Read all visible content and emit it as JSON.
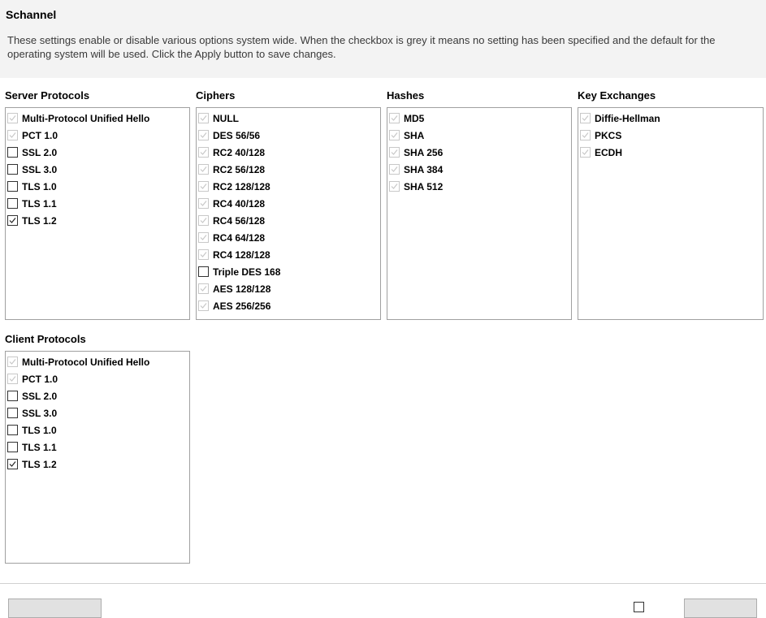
{
  "header": {
    "title": "Schannel",
    "description": "These settings enable or disable various options system wide. When the checkbox is grey it means no setting has been specified and the default for the operating system will be used. Click the Apply button to save changes."
  },
  "server_protocols": {
    "label": "Server Protocols",
    "items": [
      {
        "label": "Multi-Protocol Unified Hello",
        "state": "grey"
      },
      {
        "label": "PCT 1.0",
        "state": "grey"
      },
      {
        "label": "SSL 2.0",
        "state": "unchecked"
      },
      {
        "label": "SSL 3.0",
        "state": "unchecked"
      },
      {
        "label": "TLS 1.0",
        "state": "unchecked"
      },
      {
        "label": "TLS 1.1",
        "state": "unchecked"
      },
      {
        "label": "TLS 1.2",
        "state": "checked"
      }
    ]
  },
  "ciphers": {
    "label": "Ciphers",
    "items": [
      {
        "label": "NULL",
        "state": "grey"
      },
      {
        "label": "DES 56/56",
        "state": "grey"
      },
      {
        "label": "RC2 40/128",
        "state": "grey"
      },
      {
        "label": "RC2 56/128",
        "state": "grey"
      },
      {
        "label": "RC2 128/128",
        "state": "grey"
      },
      {
        "label": "RC4 40/128",
        "state": "grey"
      },
      {
        "label": "RC4 56/128",
        "state": "grey"
      },
      {
        "label": "RC4 64/128",
        "state": "grey"
      },
      {
        "label": "RC4 128/128",
        "state": "grey"
      },
      {
        "label": "Triple DES 168",
        "state": "unchecked"
      },
      {
        "label": "AES 128/128",
        "state": "grey"
      },
      {
        "label": "AES 256/256",
        "state": "grey"
      }
    ]
  },
  "hashes": {
    "label": "Hashes",
    "items": [
      {
        "label": "MD5",
        "state": "grey"
      },
      {
        "label": "SHA",
        "state": "grey"
      },
      {
        "label": "SHA 256",
        "state": "grey"
      },
      {
        "label": "SHA 384",
        "state": "grey"
      },
      {
        "label": "SHA 512",
        "state": "grey"
      }
    ]
  },
  "key_exchanges": {
    "label": "Key Exchanges",
    "items": [
      {
        "label": "Diffie-Hellman",
        "state": "grey"
      },
      {
        "label": "PKCS",
        "state": "grey"
      },
      {
        "label": "ECDH",
        "state": "grey"
      }
    ]
  },
  "client_protocols": {
    "label": "Client Protocols",
    "items": [
      {
        "label": "Multi-Protocol Unified Hello",
        "state": "grey"
      },
      {
        "label": "PCT 1.0",
        "state": "grey"
      },
      {
        "label": "SSL 2.0",
        "state": "unchecked"
      },
      {
        "label": "SSL 3.0",
        "state": "unchecked"
      },
      {
        "label": "TLS 1.0",
        "state": "unchecked"
      },
      {
        "label": "TLS 1.1",
        "state": "unchecked"
      },
      {
        "label": "TLS 1.2",
        "state": "checked"
      }
    ]
  }
}
